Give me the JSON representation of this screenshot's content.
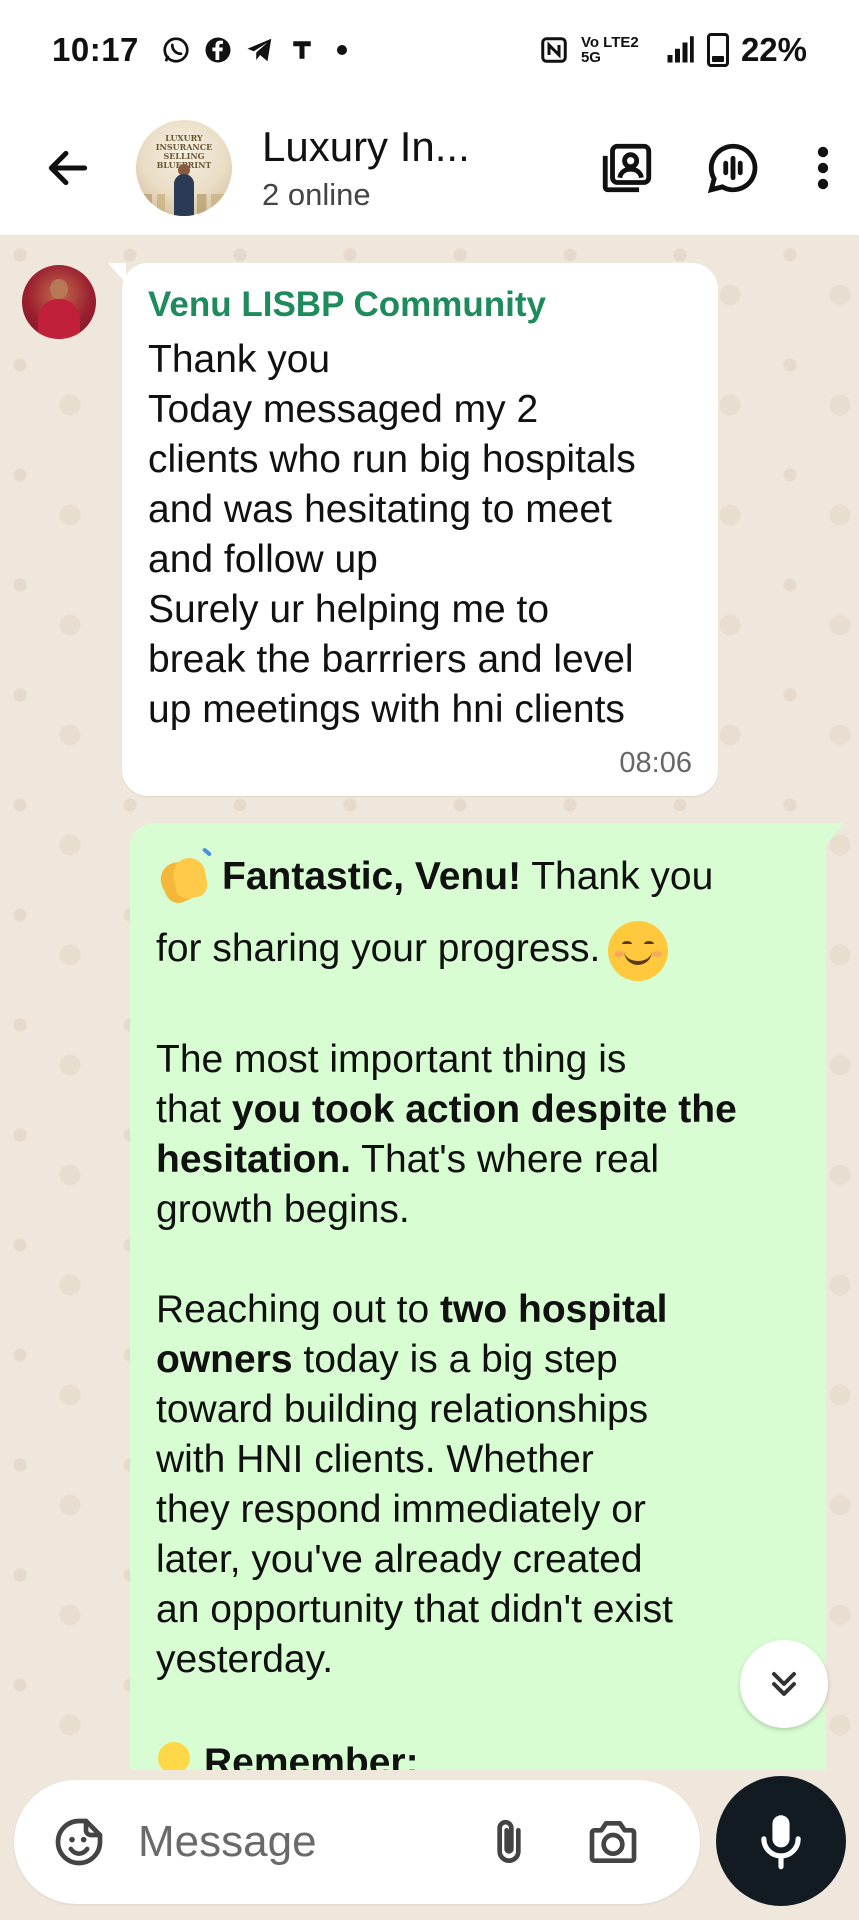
{
  "status_bar": {
    "time": "10:17",
    "network": "Vo LTE2 5G",
    "battery_percent": "22%",
    "battery_level": 0.22,
    "notification_icons": [
      "whatsapp-icon",
      "facebook-icon",
      "telegram-icon",
      "truecaller-pro-icon",
      "dot-icon"
    ],
    "system_icons": [
      "nfc-icon",
      "volte-icon",
      "5g-signal-icon",
      "signal-icon",
      "battery-icon"
    ]
  },
  "header": {
    "title": "Luxury In...",
    "subtitle": "2 online",
    "avatar_text": "LUXURY INSURANCE SELLING BLUEPRINT",
    "icons": [
      "back-arrow-icon",
      "group-avatar",
      "contact-card-icon",
      "voice-chat-icon",
      "more-vert-icon"
    ]
  },
  "messages": {
    "incoming": {
      "sender": "Venu LISBP Community",
      "lines": [
        "Thank you",
        "Today messaged my 2",
        "clients who run big hospitals",
        "and was hesitating to meet",
        "and follow up",
        "Surely ur helping me to",
        "break the barrriers and level",
        "up meetings with hni clients"
      ],
      "time": "08:06"
    },
    "outgoing": {
      "l1_bold": "Fantastic, Venu!",
      "l1_rest": " Thank you",
      "l2": "for sharing your progress.",
      "p2_l1": "The most important thing is",
      "p2_l2_pre": "that ",
      "p2_l2_bold": "you took action despite the",
      "p2_l3_bold": "hesitation.",
      "p2_l3_rest": " That's where real",
      "p2_l4": "growth begins.",
      "p3_l1_pre": "Reaching out to ",
      "p3_l1_bold": "two hospital",
      "p3_l2_bold": "owners",
      "p3_l2_rest": " today is a big step",
      "p3_l3": "toward building relationships",
      "p3_l4": "with HNI clients. Whether",
      "p3_l5": "they respond immediately or",
      "p3_l6": "later, you've already created",
      "p3_l7": "an opportunity that didn't exist",
      "p3_l8": "yesterday.",
      "p4_bold": "Remember:"
    }
  },
  "input_bar": {
    "placeholder": "Message",
    "value": ""
  },
  "colors": {
    "chat_bg": "#efe7dc",
    "incoming_bubble": "#ffffff",
    "outgoing_bubble": "#d8fdd2",
    "sender_name": "#1f8b5c",
    "mic_button": "#111b21"
  }
}
